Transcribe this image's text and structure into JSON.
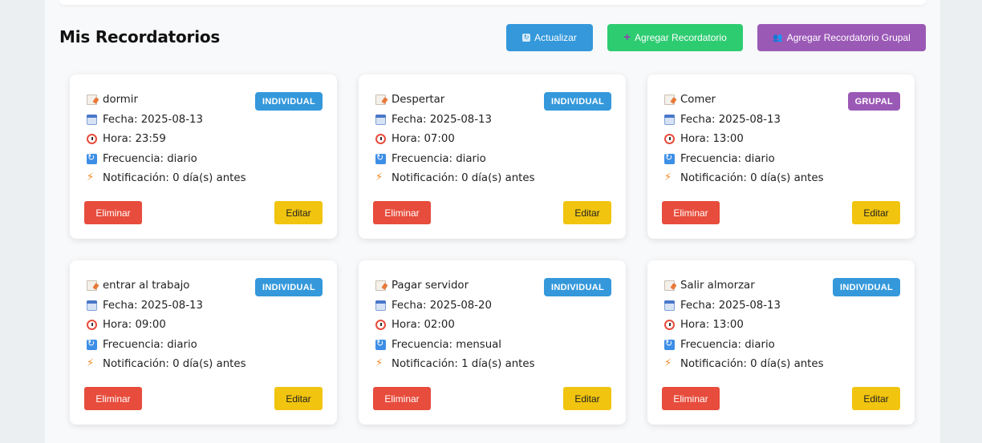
{
  "header": {
    "title": "Mis Recordatorios",
    "refresh_label": "Actualizar",
    "add_label": "Agregar Recordatorio",
    "add_group_label": "Agregar Recordatorio Grupal"
  },
  "colors": {
    "primary": "#3498db",
    "success": "#2ecc71",
    "purple": "#9b59b6",
    "danger": "#e74c3c",
    "warning": "#f1c40f"
  },
  "icons": {
    "title": "memo-icon",
    "date": "calendar-icon",
    "time": "alarm-clock-icon",
    "frequency": "repeat-icon",
    "notification": "lightning-icon"
  },
  "reminders": [
    {
      "title": "dormir",
      "badge": "INDIVIDUAL",
      "date": "Fecha: 2025-08-13",
      "time": "Hora: 23:59",
      "frequency": "Frecuencia: diario",
      "notification": "Notificación: 0 día(s) antes",
      "delete_label": "Eliminar",
      "edit_label": "Editar"
    },
    {
      "title": "Despertar",
      "badge": "INDIVIDUAL",
      "date": "Fecha: 2025-08-13",
      "time": "Hora: 07:00",
      "frequency": "Frecuencia: diario",
      "notification": "Notificación: 0 día(s) antes",
      "delete_label": "Eliminar",
      "edit_label": "Editar"
    },
    {
      "title": "Comer",
      "badge": "GRUPAL",
      "date": "Fecha: 2025-08-13",
      "time": "Hora: 13:00",
      "frequency": "Frecuencia: diario",
      "notification": "Notificación: 0 día(s) antes",
      "delete_label": "Eliminar",
      "edit_label": "Editar"
    },
    {
      "title": "entrar al trabajo",
      "badge": "INDIVIDUAL",
      "date": "Fecha: 2025-08-13",
      "time": "Hora: 09:00",
      "frequency": "Frecuencia: diario",
      "notification": "Notificación: 0 día(s) antes",
      "delete_label": "Eliminar",
      "edit_label": "Editar"
    },
    {
      "title": "Pagar servidor",
      "badge": "INDIVIDUAL",
      "date": "Fecha: 2025-08-20",
      "time": "Hora: 02:00",
      "frequency": "Frecuencia: mensual",
      "notification": "Notificación: 1 día(s) antes",
      "delete_label": "Eliminar",
      "edit_label": "Editar"
    },
    {
      "title": "Salir almorzar",
      "badge": "INDIVIDUAL",
      "date": "Fecha: 2025-08-13",
      "time": "Hora: 13:00",
      "frequency": "Frecuencia: diario",
      "notification": "Notificación: 0 día(s) antes",
      "delete_label": "Eliminar",
      "edit_label": "Editar"
    }
  ]
}
